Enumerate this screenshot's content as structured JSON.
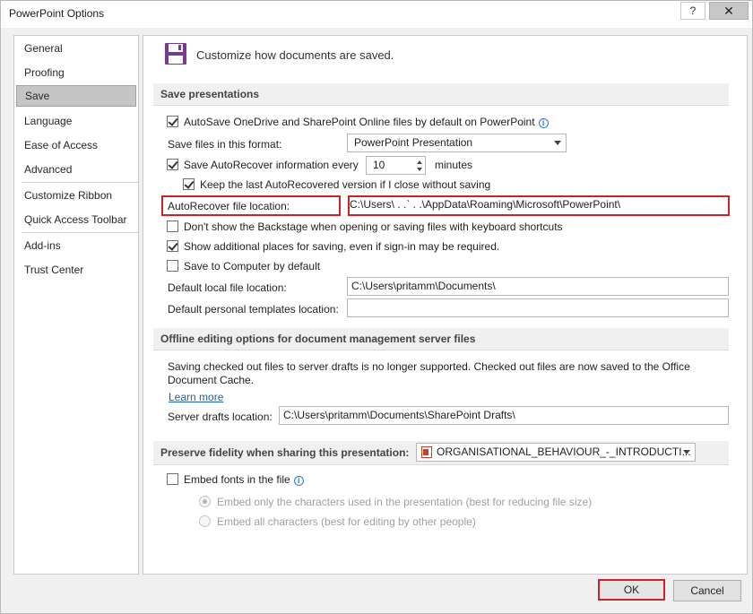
{
  "window": {
    "title": "PowerPoint Options",
    "help_btn": "?",
    "close_btn": "✕"
  },
  "sidebar": {
    "items": [
      "General",
      "Proofing",
      "Save",
      "Language",
      "Ease of Access",
      "Advanced",
      "Customize Ribbon",
      "Quick Access Toolbar",
      "Add-ins",
      "Trust Center"
    ],
    "selected": "Save"
  },
  "header": {
    "icon": "floppy-disk-icon",
    "text": "Customize how documents are saved."
  },
  "save_presentations": {
    "title": "Save presentations",
    "autosave_label": "AutoSave OneDrive and SharePoint Online files by default on PowerPoint",
    "autosave_checked": true,
    "format_label": "Save files in this format:",
    "format_value": "PowerPoint Presentation",
    "autorecover_label": "Save AutoRecover information every",
    "autorecover_checked": true,
    "autorecover_minutes": "10",
    "minutes_label": "minutes",
    "keep_last_label": "Keep the last AutoRecovered version if I close without saving",
    "keep_last_checked": true,
    "autorecover_location_label": "AutoRecover file location:",
    "autorecover_location_value": "C:\\Users\\ . .`      . .\\AppData\\Roaming\\Microsoft\\PowerPoint\\",
    "backstage_label": "Don't show the Backstage when opening or saving files with keyboard shortcuts",
    "backstage_checked": false,
    "additional_places_label": "Show additional places for saving, even if sign-in may be required.",
    "additional_places_checked": true,
    "save_computer_label": "Save to Computer by default",
    "save_computer_checked": false,
    "default_local_label": "Default local file location:",
    "default_local_value": "C:\\Users\\pritamm\\Documents\\",
    "default_templates_label": "Default personal templates location:",
    "default_templates_value": ""
  },
  "offline": {
    "title": "Offline editing options for document management server files",
    "note_line1": "Saving checked out files to server drafts is no longer supported. Checked out files are now saved to the Office",
    "note_line2": "Document Cache.",
    "learn_more": "Learn more",
    "server_drafts_label": "Server drafts location:",
    "server_drafts_value": "C:\\Users\\pritamm\\Documents\\SharePoint Drafts\\"
  },
  "fidelity": {
    "title": "Preserve fidelity when sharing this presentation:",
    "presentation_value": "ORGANISATIONAL_BEHAVIOUR_-_INTRODUCTI...",
    "embed_fonts_label": "Embed fonts in the file",
    "embed_fonts_checked": false,
    "embed_only_label": "Embed only the characters used in the presentation (best for reducing file size)",
    "embed_all_label": "Embed all characters (best for editing by other people)"
  },
  "footer": {
    "ok": "OK",
    "cancel": "Cancel"
  },
  "colors": {
    "highlight": "#d0202e",
    "link": "#1f5fa9",
    "selected_nav": "#c5c5c5"
  }
}
